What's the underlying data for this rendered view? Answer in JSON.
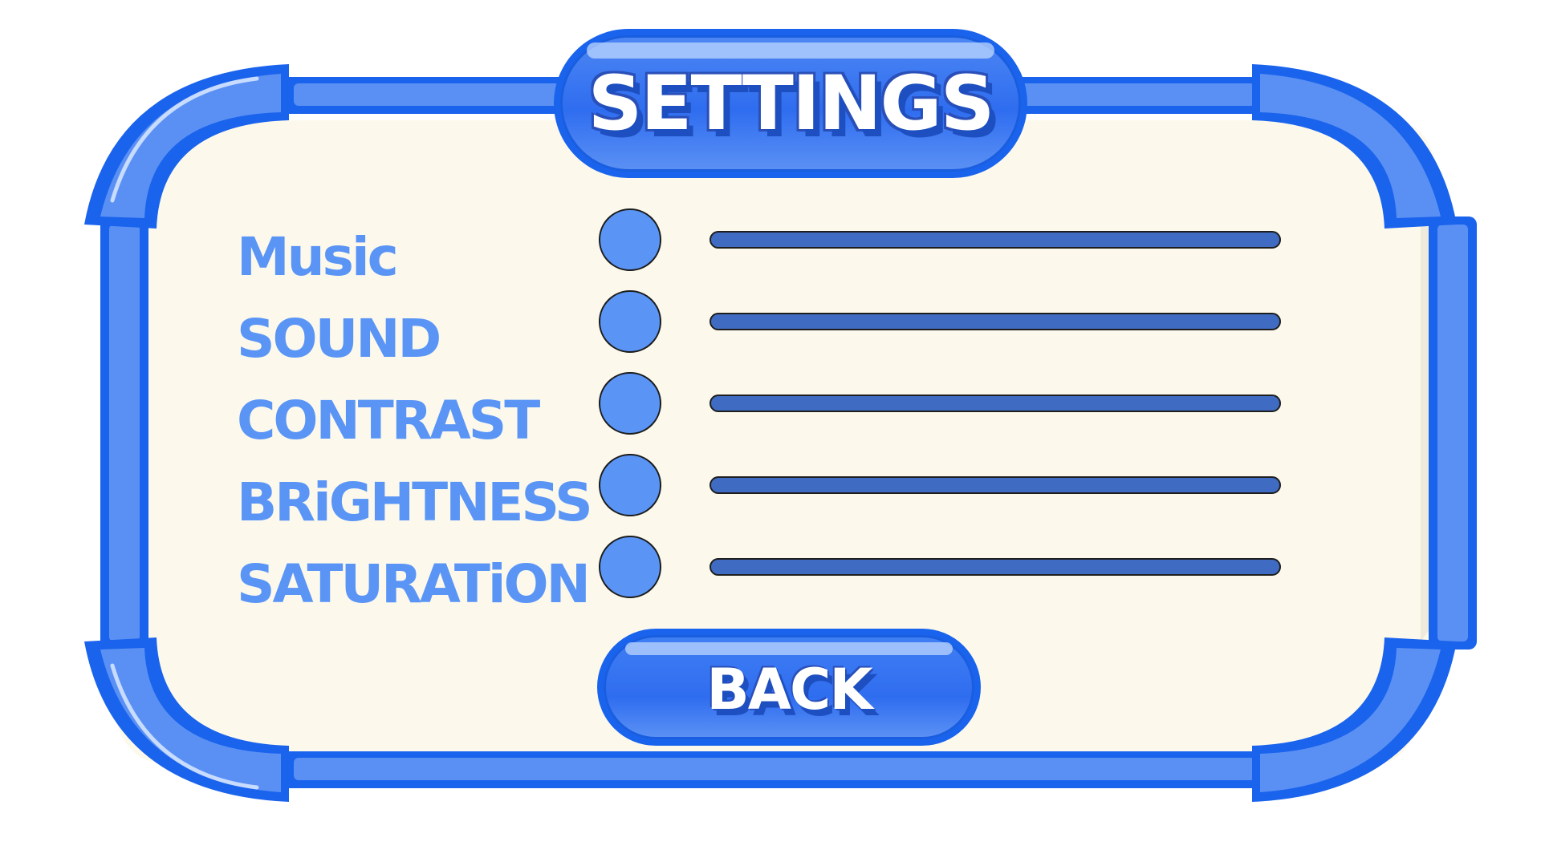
{
  "title": "SETTINGS",
  "colors": {
    "frame_blue": "#1a63ec",
    "frame_light": "#5a90f4",
    "panel_bg": "#fcf9ec",
    "label_blue": "#5a95f6",
    "track": "#3f6cc2"
  },
  "settings": [
    {
      "label": "Music",
      "level": 0
    },
    {
      "label": "SOUND",
      "level": 0
    },
    {
      "label": "CONTRAST",
      "level": 0
    },
    {
      "label": "BRiGHTNESS",
      "level": 0
    },
    {
      "label": "SATURATiON",
      "level": 0
    }
  ],
  "back_label": "BACK"
}
